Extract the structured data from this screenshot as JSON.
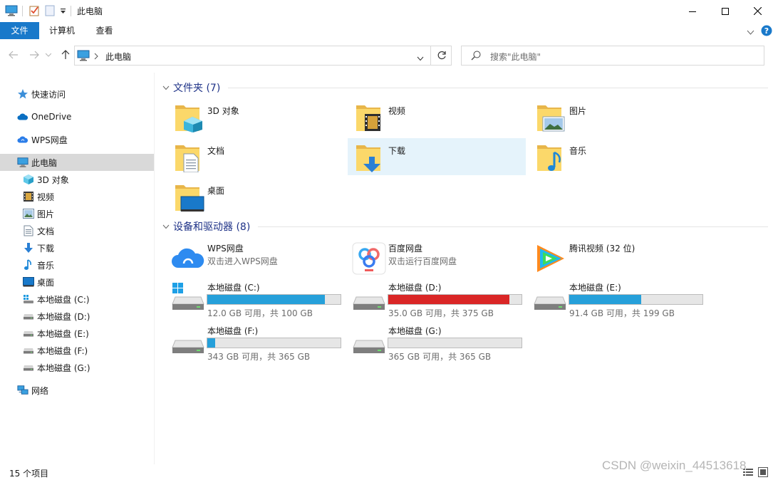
{
  "window": {
    "title": "此电脑"
  },
  "ribbon": {
    "tabs": [
      "文件",
      "计算机",
      "查看"
    ]
  },
  "address": {
    "path": "此电脑",
    "search_placeholder": "搜索\"此电脑\""
  },
  "navpane": {
    "items": [
      {
        "label": "快速访问",
        "icon": "star-icon"
      },
      {
        "label": "OneDrive",
        "icon": "cloud-icon"
      },
      {
        "label": "WPS网盘",
        "icon": "wps-cloud-icon"
      },
      {
        "label": "此电脑",
        "icon": "computer-icon",
        "selected": true
      },
      {
        "label": "3D 对象",
        "icon": "cube-icon"
      },
      {
        "label": "视频",
        "icon": "film-icon"
      },
      {
        "label": "图片",
        "icon": "picture-icon"
      },
      {
        "label": "文档",
        "icon": "document-icon"
      },
      {
        "label": "下载",
        "icon": "download-icon"
      },
      {
        "label": "音乐",
        "icon": "music-icon"
      },
      {
        "label": "桌面",
        "icon": "desktop-icon"
      },
      {
        "label": "本地磁盘 (C:)",
        "icon": "windows-drive-icon"
      },
      {
        "label": "本地磁盘 (D:)",
        "icon": "drive-icon"
      },
      {
        "label": "本地磁盘 (E:)",
        "icon": "drive-icon"
      },
      {
        "label": "本地磁盘 (F:)",
        "icon": "drive-icon"
      },
      {
        "label": "本地磁盘 (G:)",
        "icon": "drive-icon"
      },
      {
        "label": "网络",
        "icon": "network-icon"
      }
    ]
  },
  "folders": {
    "header": "文件夹 (7)",
    "items": [
      {
        "name": "3D 对象",
        "icon": "cube-folder-icon"
      },
      {
        "name": "视频",
        "icon": "video-folder-icon"
      },
      {
        "name": "图片",
        "icon": "picture-folder-icon"
      },
      {
        "name": "文档",
        "icon": "document-folder-icon"
      },
      {
        "name": "下载",
        "icon": "download-folder-icon",
        "highlighted": true
      },
      {
        "name": "音乐",
        "icon": "music-folder-icon"
      },
      {
        "name": "桌面",
        "icon": "desktop-folder-icon"
      }
    ]
  },
  "devices": {
    "header": "设备和驱动器 (8)",
    "apps": [
      {
        "name": "WPS网盘",
        "subtitle": "双击进入WPS网盘",
        "icon": "wps-cloud-icon"
      },
      {
        "name": "百度网盘",
        "subtitle": "双击运行百度网盘",
        "icon": "baidu-netdisk-icon"
      },
      {
        "name": "腾讯视频 (32 位)",
        "subtitle": "",
        "icon": "tencent-video-icon"
      }
    ],
    "drives": [
      {
        "name": "本地磁盘 (C:)",
        "free": "12.0 GB 可用，共 100 GB",
        "used_fraction": 0.88,
        "bar_color": "#26a0da",
        "icon": "windows-drive-icon"
      },
      {
        "name": "本地磁盘 (D:)",
        "free": "35.0 GB 可用，共 375 GB",
        "used_fraction": 0.907,
        "bar_color": "#da2626",
        "icon": "drive-icon"
      },
      {
        "name": "本地磁盘 (E:)",
        "free": "91.4 GB 可用，共 199 GB",
        "used_fraction": 0.54,
        "bar_color": "#26a0da",
        "icon": "drive-icon"
      },
      {
        "name": "本地磁盘 (F:)",
        "free": "343 GB 可用，共 365 GB",
        "used_fraction": 0.06,
        "bar_color": "#26a0da",
        "icon": "drive-icon"
      },
      {
        "name": "本地磁盘 (G:)",
        "free": "365 GB 可用，共 365 GB",
        "used_fraction": 0.0,
        "bar_color": "#26a0da",
        "icon": "drive-icon"
      }
    ]
  },
  "status": {
    "item_count": "15 个项目"
  },
  "watermark": "CSDN @weixin_44513618"
}
